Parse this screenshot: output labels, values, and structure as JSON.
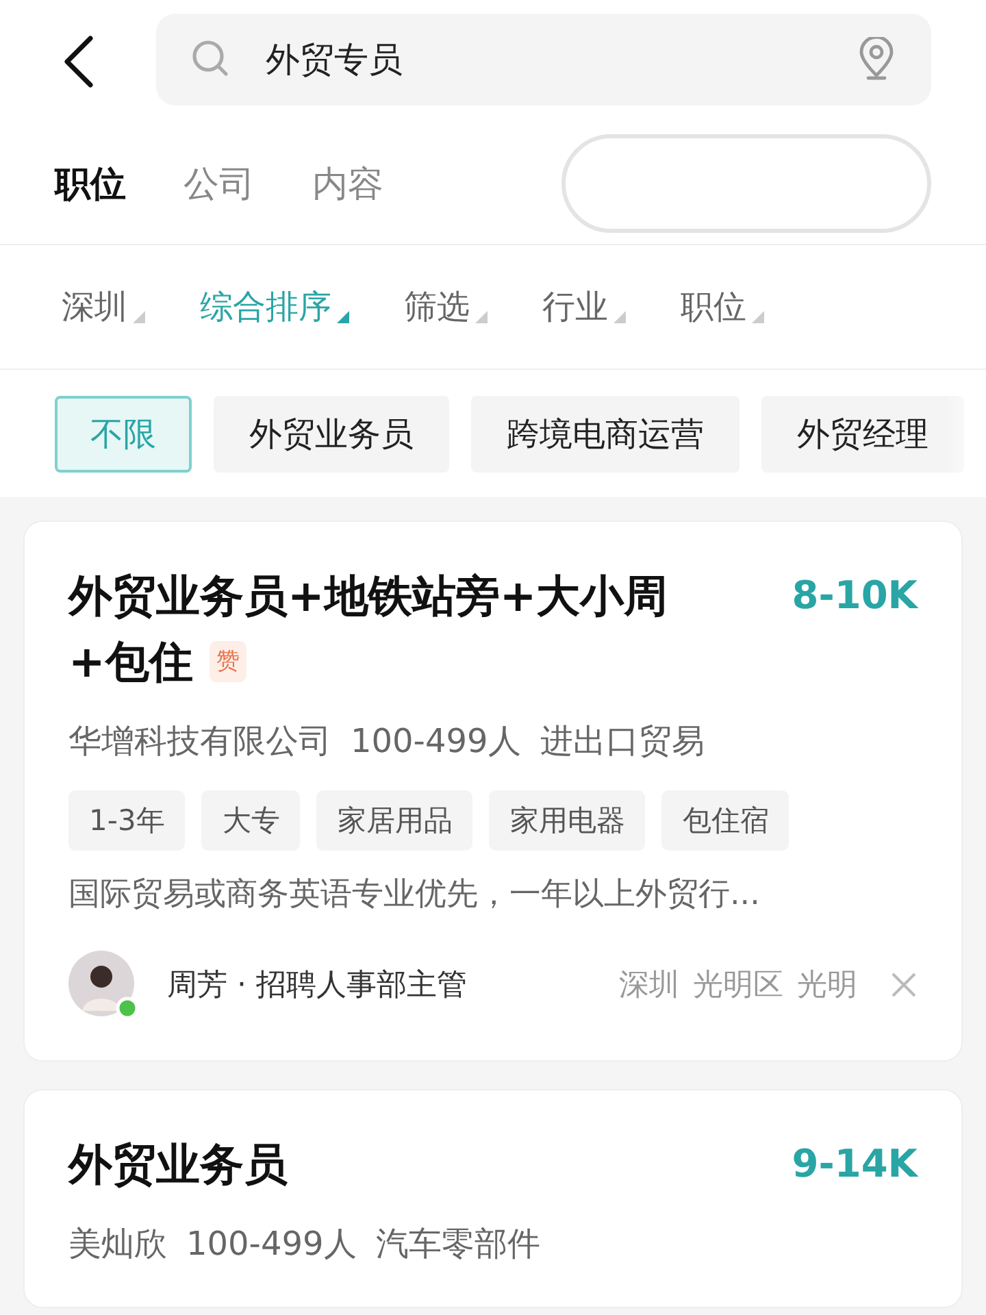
{
  "search": {
    "value": "外贸专员"
  },
  "tabs": [
    {
      "label": "职位",
      "selected": true
    },
    {
      "label": "公司",
      "selected": false
    },
    {
      "label": "内容",
      "selected": false
    }
  ],
  "filters": [
    {
      "label": "深圳",
      "selected": false
    },
    {
      "label": "综合排序",
      "selected": true
    },
    {
      "label": "筛选",
      "selected": false
    },
    {
      "label": "行业",
      "selected": false
    },
    {
      "label": "职位",
      "selected": false
    }
  ],
  "chips": [
    {
      "label": "不限",
      "selected": true
    },
    {
      "label": "外贸业务员",
      "selected": false
    },
    {
      "label": "跨境电商运营",
      "selected": false
    },
    {
      "label": "外贸经理",
      "selected": false
    }
  ],
  "jobs": [
    {
      "title_lines": [
        "外贸业务员+地铁站旁+大小周",
        "+包住"
      ],
      "badge": "赞",
      "salary": "8-10K",
      "company": "华增科技有限公司",
      "size": "100-499人",
      "industry": "进出口贸易",
      "tags": [
        "1-3年",
        "大专",
        "家居用品",
        "家用电器",
        "包住宿"
      ],
      "description": "国际贸易或商务英语专业优先，一年以上外贸行...",
      "recruiter": {
        "name": "周芳 · 招聘人事部主管",
        "online": true
      },
      "location": [
        "深圳",
        "光明区",
        "光明"
      ]
    },
    {
      "title_lines": [
        "外贸业务员"
      ],
      "salary": "9-14K",
      "company": "美灿欣",
      "size": "100-499人",
      "industry": "汽车零部件"
    }
  ]
}
